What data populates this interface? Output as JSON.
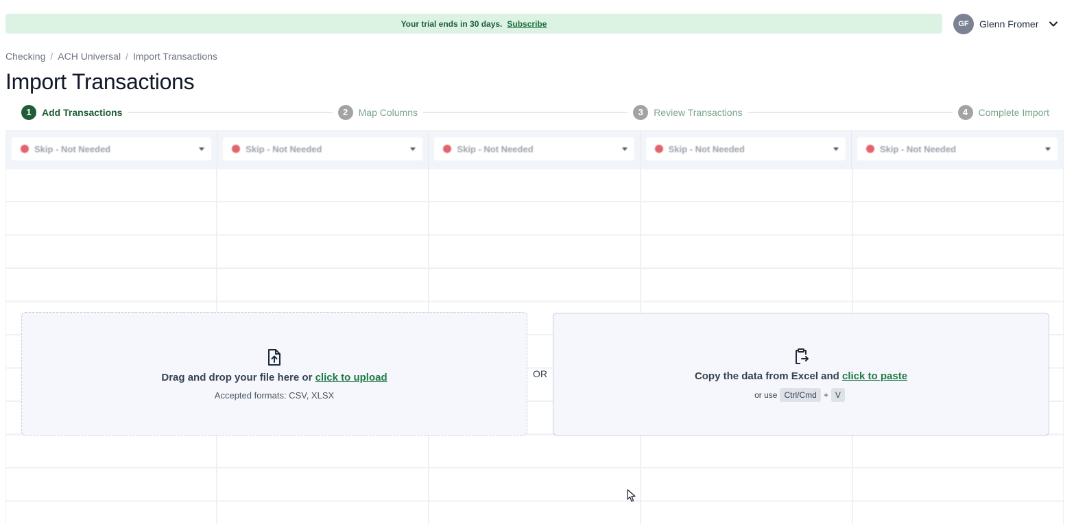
{
  "banner": {
    "text": "Your trial ends in 30 days.",
    "subscribe_label": "Subscribe"
  },
  "user": {
    "initials": "GF",
    "name": "Glenn Fromer",
    "menu_icon": "chevron-down-icon"
  },
  "breadcrumb": {
    "items": [
      "Checking",
      "ACH Universal",
      "Import Transactions"
    ],
    "separator": "/"
  },
  "page_title": "Import Transactions",
  "stepper": {
    "steps": [
      {
        "number": "1",
        "label": "Add Transactions",
        "active": true
      },
      {
        "number": "2",
        "label": "Map Columns",
        "active": false
      },
      {
        "number": "3",
        "label": "Review Transactions",
        "active": false
      },
      {
        "number": "4",
        "label": "Complete Import",
        "active": false
      }
    ]
  },
  "columns": [
    {
      "mapping": "Skip - Not Needed"
    },
    {
      "mapping": "Skip - Not Needed"
    },
    {
      "mapping": "Skip - Not Needed"
    },
    {
      "mapping": "Skip - Not Needed"
    },
    {
      "mapping": "Skip - Not Needed"
    }
  ],
  "upload": {
    "icon": "file-upload-icon",
    "prompt": "Drag and drop your file here or",
    "link_label": "click to upload",
    "formats": "Accepted formats: CSV, XLSX"
  },
  "divider_label": "OR",
  "paste": {
    "icon": "clipboard-paste-icon",
    "prompt": "Copy the data from Excel and",
    "link_label": "click to paste",
    "shortcut_prefix": "or use",
    "key_1": "Ctrl/Cmd",
    "plus": "+",
    "key_2": "V"
  },
  "colors": {
    "accent": "#1f5c37",
    "banner_bg": "#dcf3e3",
    "link": "#1f7a45",
    "skip_dot": "#e2636b"
  }
}
